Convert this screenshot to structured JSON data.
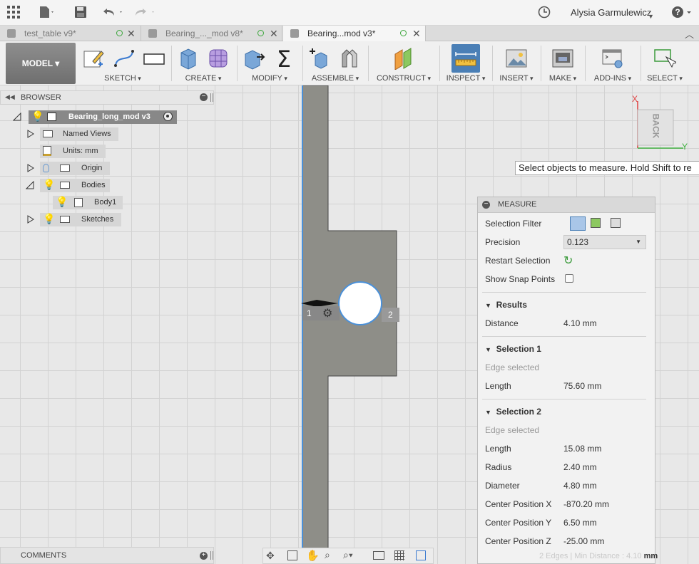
{
  "appbar": {
    "user_name": "Alysia Garmulewicz",
    "icons": [
      "grid-icon",
      "file-icon",
      "save-icon",
      "undo-icon",
      "redo-icon",
      "clock-icon",
      "help-icon"
    ]
  },
  "tabs": [
    {
      "label": "test_table v9*",
      "active": false
    },
    {
      "label": "Bearing_..._mod v8*",
      "active": false
    },
    {
      "label": "Bearing...mod v3*",
      "active": true
    }
  ],
  "toolbar": {
    "model_label": "MODEL",
    "groups": [
      "SKETCH",
      "CREATE",
      "MODIFY",
      "ASSEMBLE",
      "CONSTRUCT",
      "INSPECT",
      "INSERT",
      "MAKE",
      "ADD-INS",
      "SELECT"
    ]
  },
  "browser": {
    "title": "BROWSER",
    "root": "Bearing_long_mod v3",
    "nodes": {
      "named_views": "Named Views",
      "units": "Units: mm",
      "origin": "Origin",
      "bodies": "Bodies",
      "body1": "Body1",
      "sketches": "Sketches"
    }
  },
  "viewcube": {
    "face": "BACK",
    "axis_x": "X",
    "axis_y": "Y"
  },
  "tooltip": "Select objects to measure. Hold Shift to re",
  "markers": {
    "one": "1",
    "two": "2"
  },
  "measure": {
    "title": "MEASURE",
    "selection_filter_label": "Selection Filter",
    "precision_label": "Precision",
    "precision_value": "0.123",
    "restart_label": "Restart Selection",
    "snap_label": "Show Snap Points",
    "results": {
      "heading": "Results",
      "distance_label": "Distance",
      "distance_value": "4.10 mm"
    },
    "selection1": {
      "heading": "Selection 1",
      "type": "Edge selected",
      "length_label": "Length",
      "length_value": "75.60 mm"
    },
    "selection2": {
      "heading": "Selection 2",
      "type": "Edge selected",
      "length_label": "Length",
      "length_value": "15.08 mm",
      "radius_label": "Radius",
      "radius_value": "2.40 mm",
      "diameter_label": "Diameter",
      "diameter_value": "4.80 mm",
      "cx_label": "Center Position X",
      "cx_value": "-870.20 mm",
      "cy_label": "Center Position Y",
      "cy_value": "6.50 mm",
      "cz_label": "Center Position Z",
      "cz_value": "-25.00 mm"
    }
  },
  "comments": {
    "title": "COMMENTS"
  },
  "status": {
    "text": "2 Edges | Min Distance : 4.10",
    "unit": "mm"
  },
  "colors": {
    "accent": "#4a90d9",
    "inspect_active": "#4a7fb6",
    "part": "#8e8e88"
  }
}
